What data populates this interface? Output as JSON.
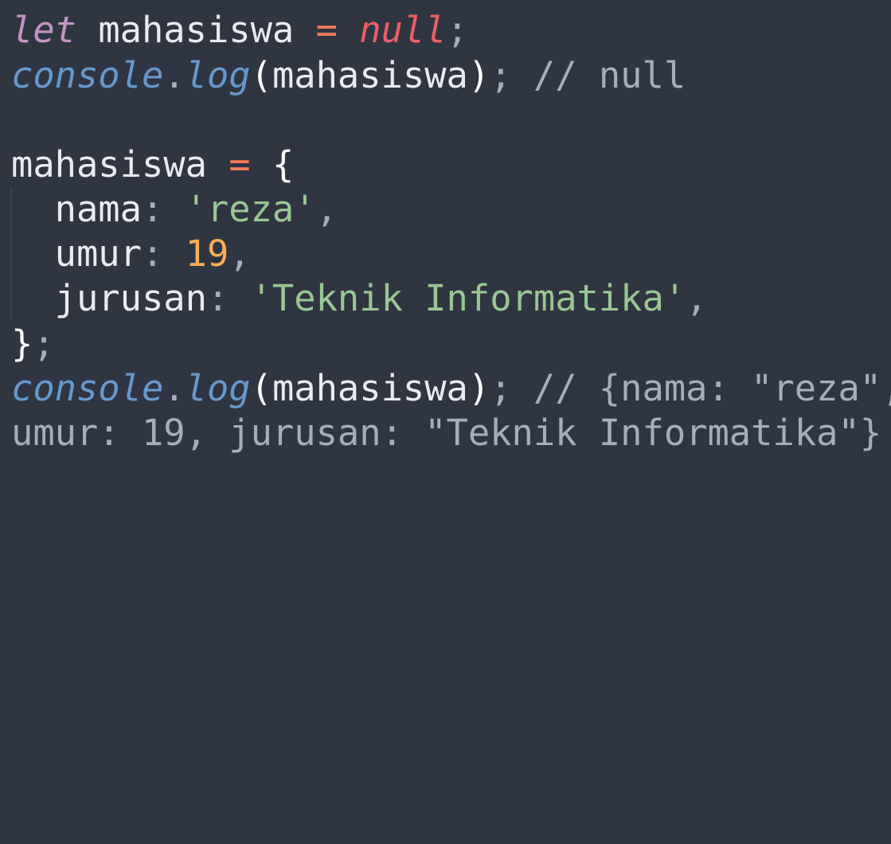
{
  "editor": {
    "line1": {
      "keyword": "let",
      "variable": "mahasiswa",
      "operator": "=",
      "value": "null",
      "semicolon": ";"
    },
    "line2": {
      "object": "console",
      "dot": ".",
      "method": "log",
      "open_paren": "(",
      "argument": "mahasiswa",
      "close_paren": ")",
      "semicolon": ";",
      "comment": "// null"
    },
    "line4": {
      "variable": "mahasiswa",
      "operator": "=",
      "open_brace": "{"
    },
    "line5": {
      "key": "nama",
      "colon": ":",
      "value": "'reza'",
      "comma": ","
    },
    "line6": {
      "key": "umur",
      "colon": ":",
      "value": "19",
      "comma": ","
    },
    "line7": {
      "key": "jurusan",
      "colon": ":",
      "value": "'Teknik Informatika'",
      "comma": ","
    },
    "line8": {
      "close_brace": "}",
      "semicolon": ";"
    },
    "line9": {
      "object": "console",
      "dot": ".",
      "method": "log",
      "open_paren": "(",
      "argument": "mahasiswa",
      "close_paren": ")",
      "semicolon": ";",
      "comment": "// {nama: \"reza\","
    },
    "line10": {
      "comment": "umur: 19, jurusan: \"Teknik Informatika\"}"
    }
  },
  "colors": {
    "background": "#2f3541",
    "keyword": "#c594c5",
    "function": "#6699cc",
    "operator": "#f97b58",
    "null": "#ec5f67",
    "string": "#99c794",
    "number": "#f9ae58",
    "comment": "#a7adba",
    "text": "#e8ecf1"
  }
}
